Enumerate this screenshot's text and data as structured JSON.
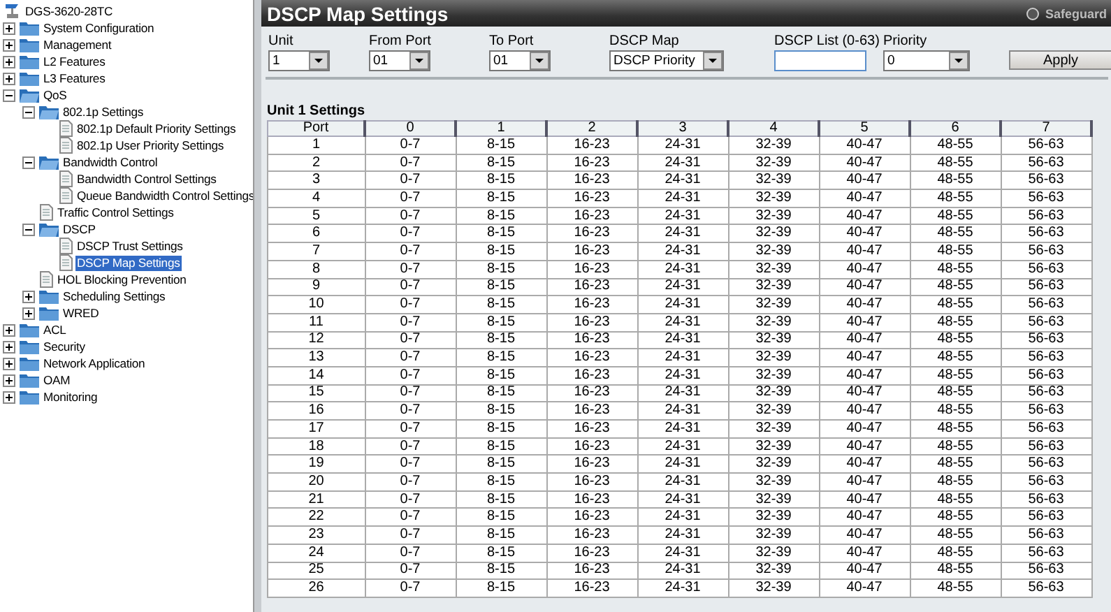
{
  "tree": {
    "root": "DGS-3620-28TC",
    "items": [
      {
        "label": "System Configuration",
        "kind": "folder",
        "expanded": false,
        "selected": false
      },
      {
        "label": "Management",
        "kind": "folder",
        "expanded": false,
        "selected": false
      },
      {
        "label": "L2 Features",
        "kind": "folder",
        "expanded": false,
        "selected": false
      },
      {
        "label": "L3 Features",
        "kind": "folder",
        "expanded": false,
        "selected": false
      },
      {
        "label": "QoS",
        "kind": "folder",
        "expanded": true,
        "selected": false,
        "children": [
          {
            "label": "802.1p Settings",
            "kind": "folder",
            "expanded": true,
            "selected": false,
            "children": [
              {
                "label": "802.1p Default Priority Settings",
                "kind": "page",
                "selected": false
              },
              {
                "label": "802.1p User Priority Settings",
                "kind": "page",
                "selected": false
              }
            ]
          },
          {
            "label": "Bandwidth Control",
            "kind": "folder",
            "expanded": true,
            "selected": false,
            "children": [
              {
                "label": "Bandwidth Control Settings",
                "kind": "page",
                "selected": false
              },
              {
                "label": "Queue Bandwidth Control Settings",
                "kind": "page",
                "selected": false
              }
            ]
          },
          {
            "label": "Traffic Control Settings",
            "kind": "page",
            "selected": false
          },
          {
            "label": "DSCP",
            "kind": "folder",
            "expanded": true,
            "selected": false,
            "children": [
              {
                "label": "DSCP Trust Settings",
                "kind": "page",
                "selected": false
              },
              {
                "label": "DSCP Map Settings",
                "kind": "page",
                "selected": true
              }
            ]
          },
          {
            "label": "HOL Blocking Prevention",
            "kind": "page",
            "selected": false
          },
          {
            "label": "Scheduling Settings",
            "kind": "folder",
            "expanded": false,
            "selected": false
          },
          {
            "label": "WRED",
            "kind": "folder",
            "expanded": false,
            "selected": false
          }
        ]
      },
      {
        "label": "ACL",
        "kind": "folder",
        "expanded": false,
        "selected": false
      },
      {
        "label": "Security",
        "kind": "folder",
        "expanded": false,
        "selected": false
      },
      {
        "label": "Network Application",
        "kind": "folder",
        "expanded": false,
        "selected": false
      },
      {
        "label": "OAM",
        "kind": "folder",
        "expanded": false,
        "selected": false
      },
      {
        "label": "Monitoring",
        "kind": "folder",
        "expanded": false,
        "selected": false
      }
    ]
  },
  "page_title": "DSCP Map Settings",
  "safeguard": "Safeguard",
  "form": {
    "fields": [
      {
        "label": "Unit",
        "kind": "select",
        "value": "1"
      },
      {
        "label": "From Port",
        "kind": "select",
        "value": "01"
      },
      {
        "label": "To Port",
        "kind": "select",
        "value": "01"
      },
      {
        "label": "DSCP Map",
        "kind": "select",
        "value": "DSCP Priority"
      },
      {
        "label": "DSCP List (0-63)",
        "kind": "input"
      },
      {
        "label": "Priority",
        "kind": "select",
        "value": "0"
      }
    ],
    "button": "Apply"
  },
  "table": {
    "title": "Unit 1 Settings",
    "columns": [
      "Port",
      "0",
      "1",
      "2",
      "3",
      "4",
      "5",
      "6",
      "7"
    ],
    "rows": [
      [
        "1",
        "0-7",
        "8-15",
        "16-23",
        "24-31",
        "32-39",
        "40-47",
        "48-55",
        "56-63"
      ],
      [
        "2",
        "0-7",
        "8-15",
        "16-23",
        "24-31",
        "32-39",
        "40-47",
        "48-55",
        "56-63"
      ],
      [
        "3",
        "0-7",
        "8-15",
        "16-23",
        "24-31",
        "32-39",
        "40-47",
        "48-55",
        "56-63"
      ],
      [
        "4",
        "0-7",
        "8-15",
        "16-23",
        "24-31",
        "32-39",
        "40-47",
        "48-55",
        "56-63"
      ],
      [
        "5",
        "0-7",
        "8-15",
        "16-23",
        "24-31",
        "32-39",
        "40-47",
        "48-55",
        "56-63"
      ],
      [
        "6",
        "0-7",
        "8-15",
        "16-23",
        "24-31",
        "32-39",
        "40-47",
        "48-55",
        "56-63"
      ],
      [
        "7",
        "0-7",
        "8-15",
        "16-23",
        "24-31",
        "32-39",
        "40-47",
        "48-55",
        "56-63"
      ],
      [
        "8",
        "0-7",
        "8-15",
        "16-23",
        "24-31",
        "32-39",
        "40-47",
        "48-55",
        "56-63"
      ],
      [
        "9",
        "0-7",
        "8-15",
        "16-23",
        "24-31",
        "32-39",
        "40-47",
        "48-55",
        "56-63"
      ],
      [
        "10",
        "0-7",
        "8-15",
        "16-23",
        "24-31",
        "32-39",
        "40-47",
        "48-55",
        "56-63"
      ],
      [
        "11",
        "0-7",
        "8-15",
        "16-23",
        "24-31",
        "32-39",
        "40-47",
        "48-55",
        "56-63"
      ],
      [
        "12",
        "0-7",
        "8-15",
        "16-23",
        "24-31",
        "32-39",
        "40-47",
        "48-55",
        "56-63"
      ],
      [
        "13",
        "0-7",
        "8-15",
        "16-23",
        "24-31",
        "32-39",
        "40-47",
        "48-55",
        "56-63"
      ],
      [
        "14",
        "0-7",
        "8-15",
        "16-23",
        "24-31",
        "32-39",
        "40-47",
        "48-55",
        "56-63"
      ],
      [
        "15",
        "0-7",
        "8-15",
        "16-23",
        "24-31",
        "32-39",
        "40-47",
        "48-55",
        "56-63"
      ],
      [
        "16",
        "0-7",
        "8-15",
        "16-23",
        "24-31",
        "32-39",
        "40-47",
        "48-55",
        "56-63"
      ],
      [
        "17",
        "0-7",
        "8-15",
        "16-23",
        "24-31",
        "32-39",
        "40-47",
        "48-55",
        "56-63"
      ],
      [
        "18",
        "0-7",
        "8-15",
        "16-23",
        "24-31",
        "32-39",
        "40-47",
        "48-55",
        "56-63"
      ],
      [
        "19",
        "0-7",
        "8-15",
        "16-23",
        "24-31",
        "32-39",
        "40-47",
        "48-55",
        "56-63"
      ],
      [
        "20",
        "0-7",
        "8-15",
        "16-23",
        "24-31",
        "32-39",
        "40-47",
        "48-55",
        "56-63"
      ],
      [
        "21",
        "0-7",
        "8-15",
        "16-23",
        "24-31",
        "32-39",
        "40-47",
        "48-55",
        "56-63"
      ],
      [
        "22",
        "0-7",
        "8-15",
        "16-23",
        "24-31",
        "32-39",
        "40-47",
        "48-55",
        "56-63"
      ],
      [
        "23",
        "0-7",
        "8-15",
        "16-23",
        "24-31",
        "32-39",
        "40-47",
        "48-55",
        "56-63"
      ],
      [
        "24",
        "0-7",
        "8-15",
        "16-23",
        "24-31",
        "32-39",
        "40-47",
        "48-55",
        "56-63"
      ],
      [
        "25",
        "0-7",
        "8-15",
        "16-23",
        "24-31",
        "32-39",
        "40-47",
        "48-55",
        "56-63"
      ],
      [
        "26",
        "0-7",
        "8-15",
        "16-23",
        "24-31",
        "32-39",
        "40-47",
        "48-55",
        "56-63"
      ]
    ]
  }
}
